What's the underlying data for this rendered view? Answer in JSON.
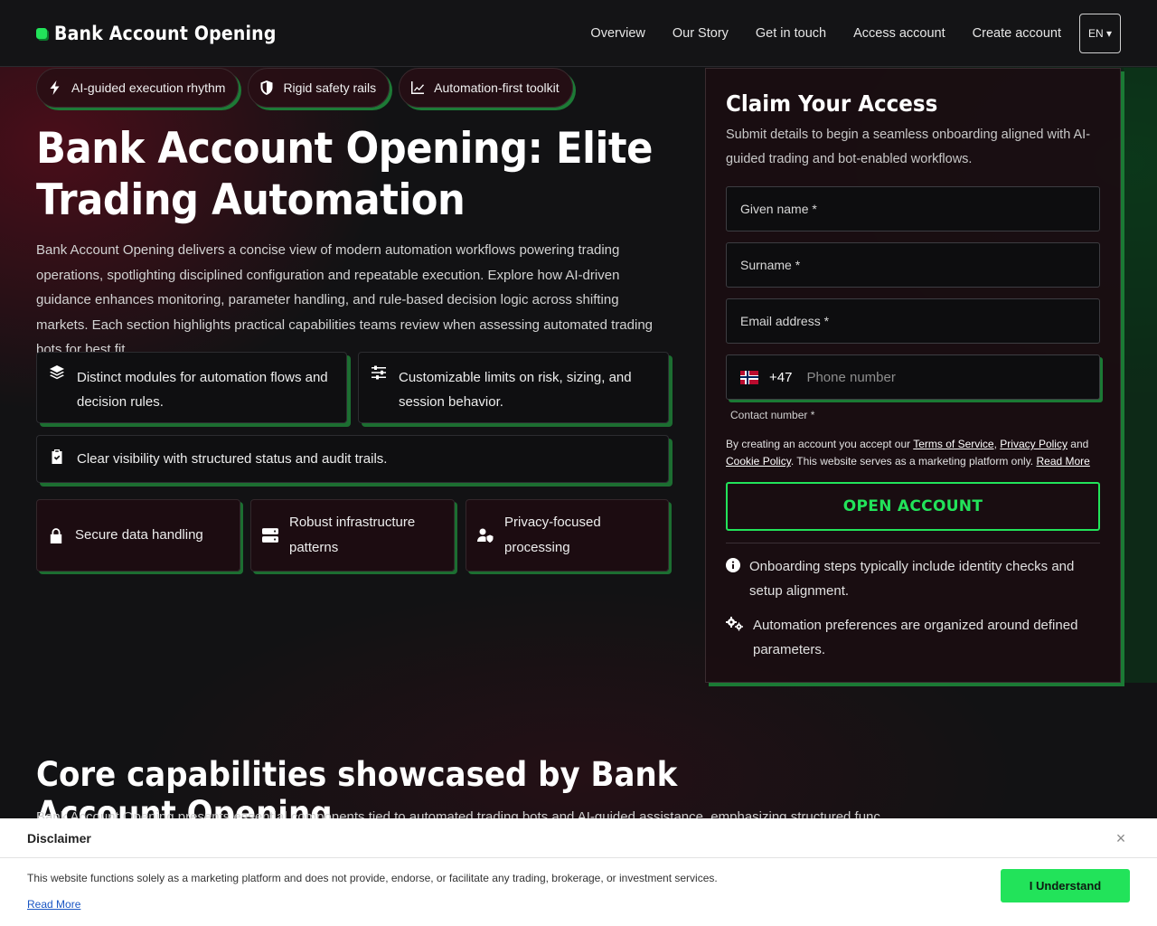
{
  "header": {
    "brand": "Bank Account Opening",
    "nav": [
      "Overview",
      "Our Story",
      "Get in touch",
      "Access account",
      "Create account"
    ],
    "language": "EN ▾"
  },
  "chips": [
    {
      "label": "AI-guided execution rhythm",
      "icon": "bolt-icon"
    },
    {
      "label": "Rigid safety rails",
      "icon": "shield-icon"
    },
    {
      "label": "Automation-first toolkit",
      "icon": "chart-line-icon"
    }
  ],
  "hero": {
    "title": "Bank Account Opening: Elite Trading Automation",
    "intro": "Bank Account Opening delivers a concise view of modern automation workflows powering trading operations, spotlighting disciplined configuration and repeatable execution. Explore how AI-driven guidance enhances monitoring, parameter handling, and rule-based decision logic across shifting markets. Each section highlights practical capabilities teams review when assessing automated trading bots for best fit."
  },
  "features": [
    {
      "label": "Distinct modules for automation flows and decision rules.",
      "icon": "layers-icon"
    },
    {
      "label": "Customizable limits on risk, sizing, and session behavior.",
      "icon": "sliders-icon"
    },
    {
      "label": "Clear visibility with structured status and audit trails.",
      "icon": "clipboard-check-icon"
    }
  ],
  "mini_features": [
    {
      "label": "Secure data handling",
      "icon": "lock-icon"
    },
    {
      "label": "Robust infrastructure patterns",
      "icon": "server-icon"
    },
    {
      "label": "Privacy-focused processing",
      "icon": "user-shield-icon"
    }
  ],
  "form": {
    "title": "Claim Your Access",
    "subtitle": "Submit details to begin a seamless onboarding aligned with AI-guided trading and bot-enabled workflows.",
    "given_name_placeholder": "Given name *",
    "surname_placeholder": "Surname *",
    "email_placeholder": "Email address *",
    "phone_country_code": "+47",
    "phone_placeholder": "Phone number",
    "contact_label": "Contact number *",
    "terms_prefix": "By creating an account you accept our ",
    "terms_link": "Terms of Service",
    "privacy_link": "Privacy Policy",
    "and_text": " and ",
    "cookie_link": "Cookie Policy",
    "terms_suffix": ". This website serves as a marketing platform only. ",
    "read_more": "Read More",
    "submit": "OPEN ACCOUNT",
    "notes": [
      {
        "label": "Onboarding steps typically include identity checks and setup alignment.",
        "icon": "info-icon"
      },
      {
        "label": "Automation preferences are organized around defined parameters.",
        "icon": "gears-icon"
      }
    ]
  },
  "core": {
    "title": "Core capabilities showcased by Bank Account Opening",
    "text": "Bank Account Opening presents essential components tied to automated trading bots and AI-guided assistance, emphasizing structured func"
  },
  "disclaimer": {
    "title": "Disclaimer",
    "close": "×",
    "text": "This website functions solely as a marketing platform and does not provide, endorse, or facilitate any trading, brokerage, or investment services.",
    "read_more": "Read More",
    "button": "I Understand"
  },
  "colors": {
    "accent": "#22e35a",
    "background": "#121214",
    "card": "#1a0e12"
  }
}
